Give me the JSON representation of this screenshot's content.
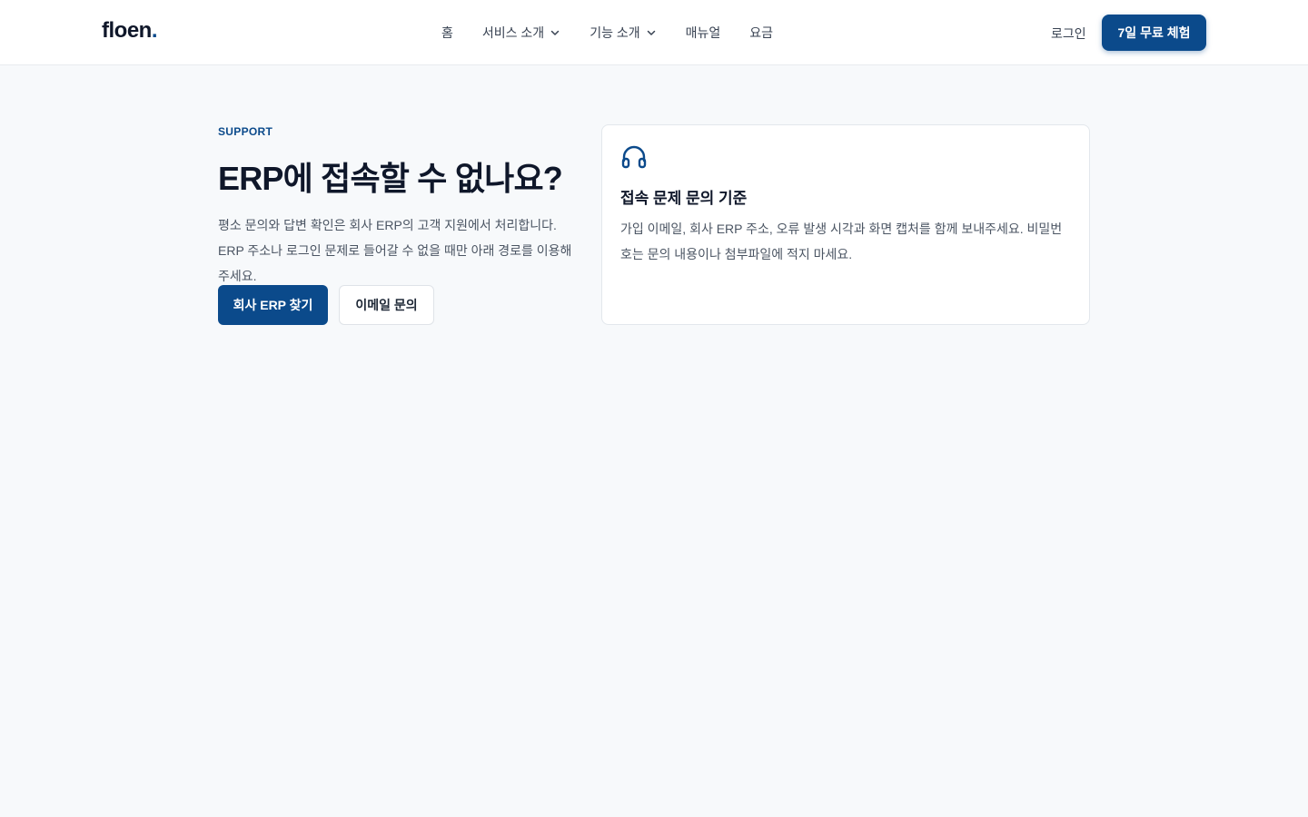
{
  "header": {
    "logo_text": "floen",
    "logo_dot": ".",
    "nav": [
      {
        "label": "홈",
        "has_dropdown": false
      },
      {
        "label": "서비스 소개",
        "has_dropdown": true
      },
      {
        "label": "기능 소개",
        "has_dropdown": true
      },
      {
        "label": "매뉴얼",
        "has_dropdown": false
      },
      {
        "label": "요금",
        "has_dropdown": false
      }
    ],
    "login_label": "로그인",
    "trial_label": "7일 무료 체험"
  },
  "hero": {
    "eyebrow": "SUPPORT",
    "title": "ERP에 접속할 수 없나요?",
    "description": "평소 문의와 답변 확인은 회사 ERP의 고객 지원에서 처리합니다. ERP 주소나 로그인 문제로 들어갈 수 없을 때만 아래 경로를 이용해 주세요.",
    "primary_button": "회사 ERP 찾기",
    "secondary_button": "이메일 문의"
  },
  "card": {
    "icon": "headphones-icon",
    "title": "접속 문제 문의 기준",
    "body": "가입 이메일, 회사 ERP 주소, 오류 발생 시각과 화면 캡처를 함께 보내주세요. 비밀번호는 문의 내용이나 첨부파일에 적지 마세요."
  },
  "colors": {
    "brand": "#0b4a8b",
    "background": "#f7f9fb",
    "text": "#0f172a"
  }
}
